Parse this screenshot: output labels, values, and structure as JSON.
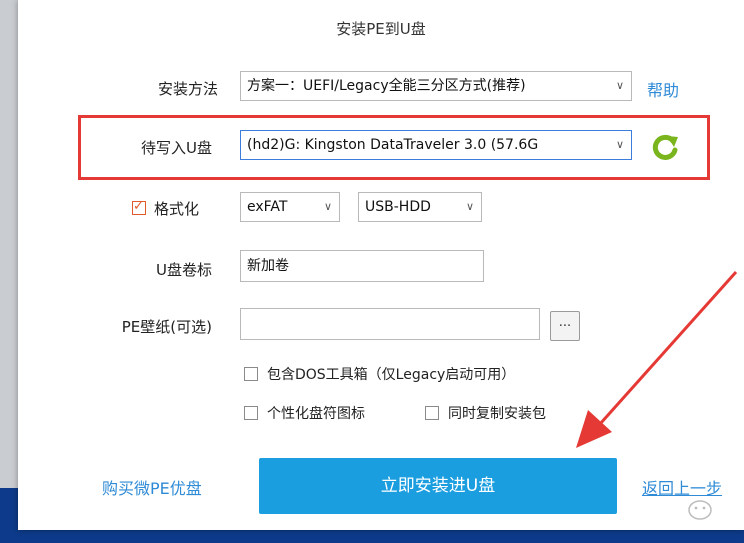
{
  "dialog": {
    "title": "安装PE到U盘",
    "install_method": {
      "label": "安装方法",
      "value": "方案一：UEFI/Legacy全能三分区方式(推荐)",
      "help_link": "帮助"
    },
    "target_disk": {
      "label": "待写入U盘",
      "value": "(hd2)G: Kingston DataTraveler 3.0 (57.6G",
      "refresh_icon": "refresh-icon"
    },
    "format": {
      "checkbox_label": "格式化",
      "checked": true,
      "filesystem": "exFAT",
      "mode": "USB-HDD"
    },
    "volume_label": {
      "label": "U盘卷标",
      "value": "新加卷"
    },
    "wallpaper": {
      "label": "PE壁纸(可选)",
      "value": "",
      "browse_label": "..."
    },
    "options": {
      "include_dos": "包含DOS工具箱（仅Legacy启动可用）",
      "personalize_icon": "个性化盘符图标",
      "copy_installer": "同时复制安装包"
    },
    "footer": {
      "buy_link": "购买微PE优盘",
      "install_button": "立即安装进U盘",
      "back_link": "返回上一步"
    }
  },
  "colors": {
    "accent": "#1a9ee0",
    "link": "#2f8bd6",
    "highlight": "#e53935",
    "refresh": "#7ab51d"
  }
}
